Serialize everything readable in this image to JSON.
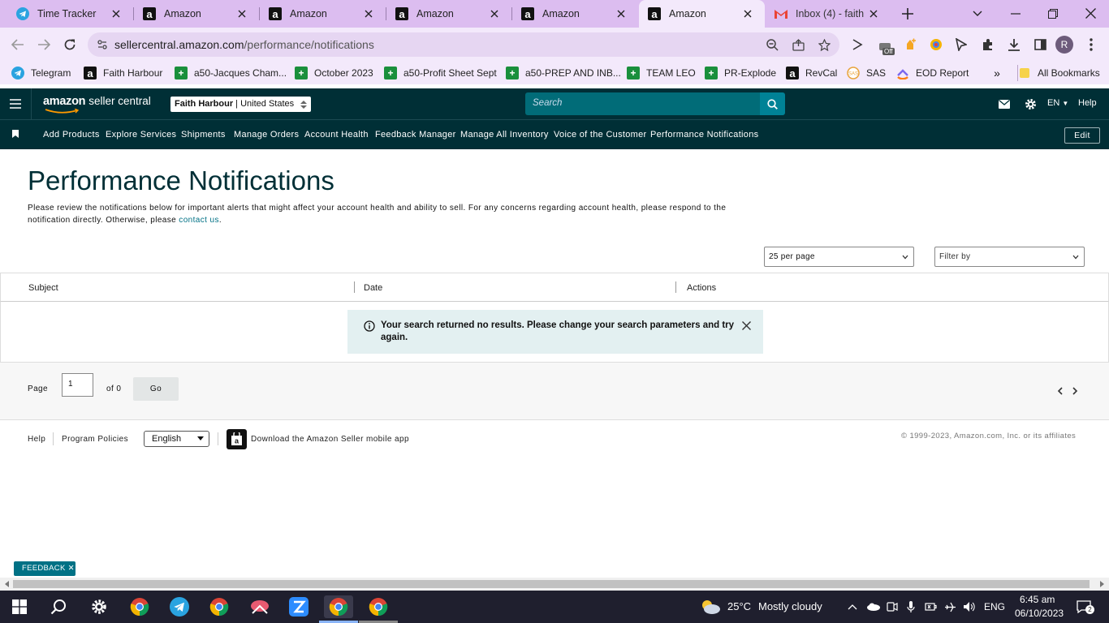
{
  "browser": {
    "tabs": [
      {
        "title": "Time Tracker",
        "favicon": "telegram-icon"
      },
      {
        "title": "Amazon",
        "favicon": "amazon-icon"
      },
      {
        "title": "Amazon",
        "favicon": "amazon-icon"
      },
      {
        "title": "Amazon",
        "favicon": "amazon-icon"
      },
      {
        "title": "Amazon",
        "favicon": "amazon-icon"
      },
      {
        "title": "Amazon",
        "favicon": "amazon-icon",
        "active": true
      },
      {
        "title": "Inbox (4) - faith",
        "favicon": "gmail-icon"
      }
    ],
    "url_host": "sellercentral.amazon.com",
    "url_path": "/performance/notifications",
    "profile_initial": "R",
    "extension_badge": "Off",
    "bookmarks": [
      {
        "label": "Telegram",
        "icon": "telegram-icon"
      },
      {
        "label": "Faith Harbour",
        "icon": "amazon-icon"
      },
      {
        "label": "a50-Jacques Cham...",
        "icon": "sheets-icon"
      },
      {
        "label": "October 2023",
        "icon": "sheets-icon"
      },
      {
        "label": "a50-Profit Sheet Sept",
        "icon": "sheets-icon"
      },
      {
        "label": "a50-PREP AND INB...",
        "icon": "sheets-icon"
      },
      {
        "label": "TEAM LEO",
        "icon": "sheets-icon"
      },
      {
        "label": "PR-Explode",
        "icon": "sheets-icon"
      },
      {
        "label": "RevCal",
        "icon": "amazon-icon"
      },
      {
        "label": "SAS",
        "icon": "sas-icon"
      },
      {
        "label": "EOD Report",
        "icon": "clickup-icon"
      }
    ],
    "all_bookmarks": "All Bookmarks"
  },
  "header": {
    "logo_brand": "amazon",
    "logo_product": "seller central",
    "store_name": "Faith Harbour",
    "marketplace": "United States",
    "search_placeholder": "Search",
    "language": "EN",
    "help": "Help"
  },
  "subnav": {
    "items": [
      "Add Products",
      "Explore Services",
      "Shipments",
      "Manage Orders",
      "Account Health",
      "Feedback Manager",
      "Manage All Inventory",
      "Voice of the Customer",
      "Performance Notifications"
    ],
    "edit": "Edit"
  },
  "main": {
    "title": "Performance Notifications",
    "description": "Please review the notifications below for important alerts that might affect your account health and ability to sell. For any concerns regarding account health, please respond to the notification directly. Otherwise, please ",
    "contact_link": "contact us",
    "description_end": ".",
    "per_page": "25 per page",
    "filter_by": "Filter by",
    "columns": [
      "Subject",
      "Date",
      "Actions"
    ],
    "alert_message": "Your search returned no results. Please change your search parameters and try again."
  },
  "pager": {
    "page_label": "Page",
    "page_value": "1",
    "of_label": "of 0",
    "go": "Go"
  },
  "footer": {
    "help": "Help",
    "program_policies": "Program Policies",
    "language": "English",
    "app_text": "Download the Amazon Seller mobile app",
    "copyright": "© 1999-2023, Amazon.com, Inc. or its affiliates"
  },
  "feedback": "FEEDBACK",
  "taskbar": {
    "temperature": "25°C",
    "weather": "Mostly cloudy",
    "lang": "ENG",
    "time": "6:45 am",
    "date": "06/10/2023",
    "notifications": "2"
  }
}
